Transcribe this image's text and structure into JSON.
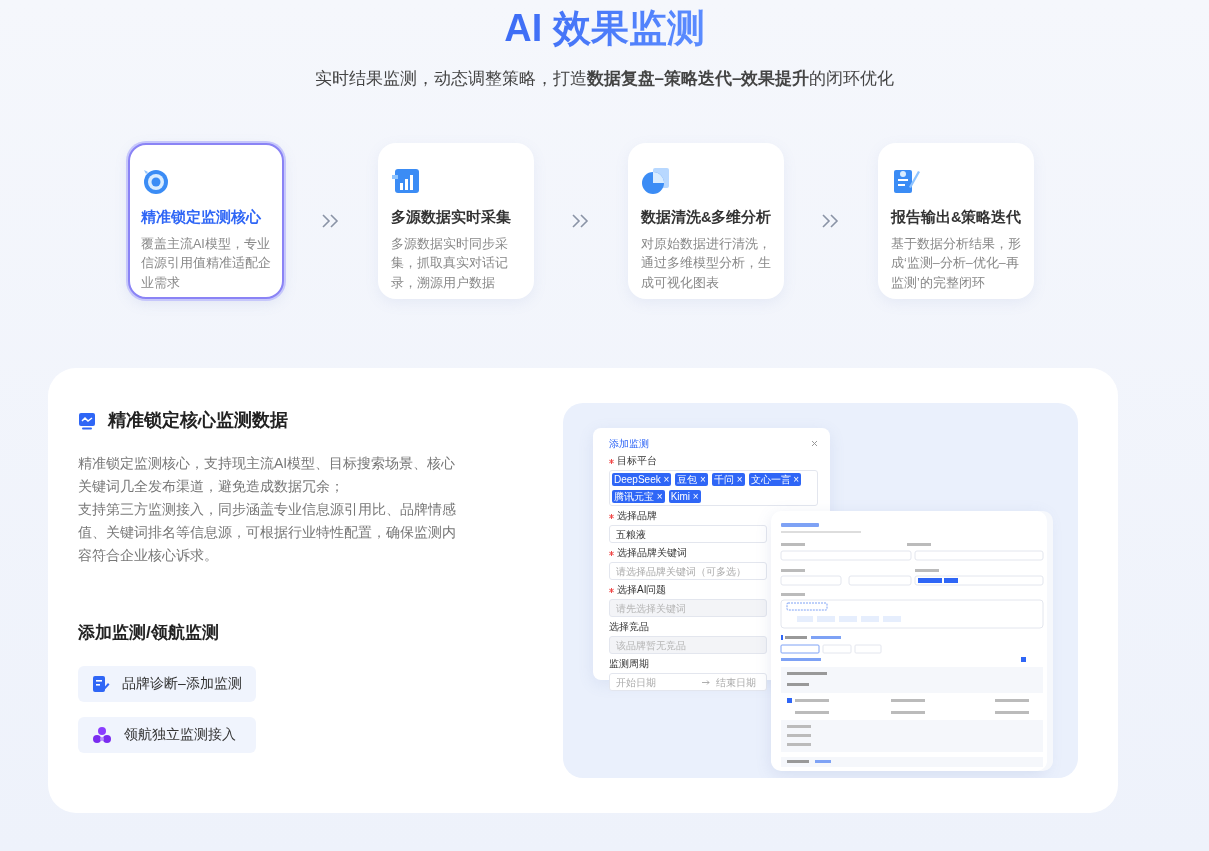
{
  "header": {
    "title": "AI 效果监测",
    "subtitle": "实时结果监测，动态调整策略，打造**数据复盘–策略迭代–效果提升**的闭环优化"
  },
  "steps": [
    {
      "title": "精准锁定监测核心",
      "description": "覆盖主流AI模型，专业信源引用值精准适配企业需求",
      "selected": true
    },
    {
      "title": "多源数据实时采集",
      "description": "多源数据实时同步采集，抓取真实对话记录，溯源用户数据",
      "selected": false
    },
    {
      "title": "数据清洗&多维分析",
      "description": "对原始数据进行清洗，通过多维模型分析，生成可视化图表",
      "selected": false
    },
    {
      "title": "报告输出&策略迭代",
      "description": "基于数据分析结果，形成‘监测–分析–优化–再监测’的完整闭环",
      "selected": false
    }
  ],
  "feature": {
    "title": "精准锁定核心监测数据",
    "paragraphs": [
      "精准锁定监测核心，支持现主流AI模型、目标搜索场景、核心关键词几全发布渠道，避免造成数据冗余；",
      "支持第三方监测接入，同步涵盖专业信息源引用比、品牌情感值、关键词排名等信息源，可根据行业特性配置，确保监测内容符合企业核心诉求。"
    ],
    "section_title": "添加监测/领航监测",
    "actions": [
      {
        "label": "品牌诊断–添加监测"
      },
      {
        "label": "领航独立监测接入"
      }
    ]
  },
  "preview": {
    "dialog": {
      "title": "添加监测",
      "fields": [
        {
          "kind": "tags",
          "label": "目标平台",
          "required": true,
          "tags": [
            "DeepSeek ×",
            "豆包 ×",
            "千问 ×",
            "文心一言 ×",
            "腾讯元宝 ×",
            "Kimi ×"
          ]
        },
        {
          "kind": "input",
          "label": "选择品牌",
          "required": true,
          "value": "五粮液"
        },
        {
          "kind": "input",
          "label": "选择品牌关键词",
          "required": true,
          "placeholder": "请选择品牌关键词（可多选）"
        },
        {
          "kind": "disabled",
          "label": "选择AI问题",
          "required": true,
          "placeholder": "请先选择关键词"
        },
        {
          "kind": "disabled",
          "label": "选择竞品",
          "required": false,
          "placeholder": "该品牌暂无竞品"
        },
        {
          "kind": "daterange",
          "label": "监测周期",
          "required": false,
          "start": "开始日期",
          "end": "结束日期"
        }
      ]
    }
  }
}
